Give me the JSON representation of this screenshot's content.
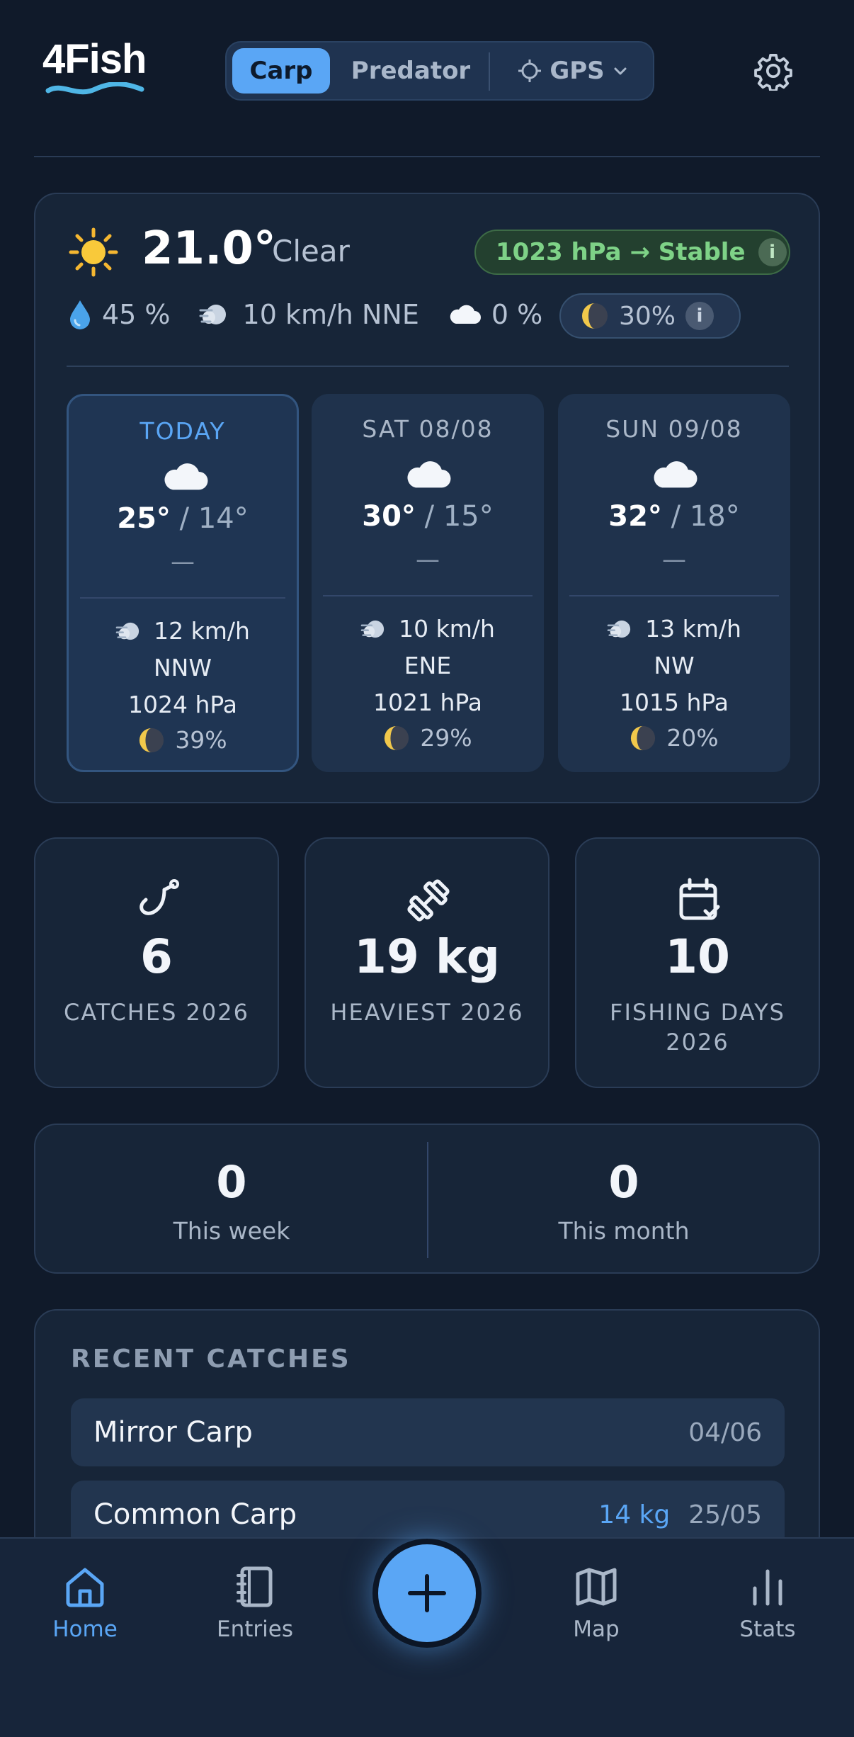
{
  "header": {
    "logo": "4Fish",
    "tabs": {
      "carp": "Carp",
      "predator": "Predator",
      "gps": "GPS"
    }
  },
  "weather": {
    "current": {
      "temp": "21.0°",
      "condition": "Clear",
      "pressure": "1023 hPa → Stable",
      "humidity": "45 %",
      "wind": "10 km/h NNE",
      "cloud": "0 %",
      "moon": "30%"
    },
    "days": [
      {
        "label": "TODAY",
        "high": "25°",
        "low": "14°",
        "precip": "—",
        "wind": "12 km/h",
        "dir": "NNW",
        "pressure": "1024 hPa",
        "moon": "39%"
      },
      {
        "label": "SAT 08/08",
        "high": "30°",
        "low": "15°",
        "precip": "—",
        "wind": "10 km/h",
        "dir": "ENE",
        "pressure": "1021 hPa",
        "moon": "29%"
      },
      {
        "label": "SUN 09/08",
        "high": "32°",
        "low": "18°",
        "precip": "—",
        "wind": "13 km/h",
        "dir": "NW",
        "pressure": "1015 hPa",
        "moon": "20%"
      }
    ],
    "temp_separator": "/"
  },
  "stats": [
    {
      "value": "6",
      "label": "CATCHES 2026"
    },
    {
      "value": "19 kg",
      "label": "HEAVIEST 2026"
    },
    {
      "value": "10",
      "label": "FISHING DAYS 2026"
    }
  ],
  "periods": {
    "week": {
      "value": "0",
      "label": "This week"
    },
    "month": {
      "value": "0",
      "label": "This month"
    }
  },
  "recent": {
    "title": "RECENT CATCHES",
    "items": [
      {
        "name": "Mirror Carp",
        "weight": "",
        "date": "04/06"
      },
      {
        "name": "Common Carp",
        "weight": "14 kg",
        "date": "25/05"
      }
    ]
  },
  "nav": {
    "home": "Home",
    "entries": "Entries",
    "map": "Map",
    "stats": "Stats"
  },
  "colors": {
    "background": "#101a2a",
    "card": "#172538",
    "accent": "#5aa6f5",
    "stable_green": "#7ed287"
  }
}
